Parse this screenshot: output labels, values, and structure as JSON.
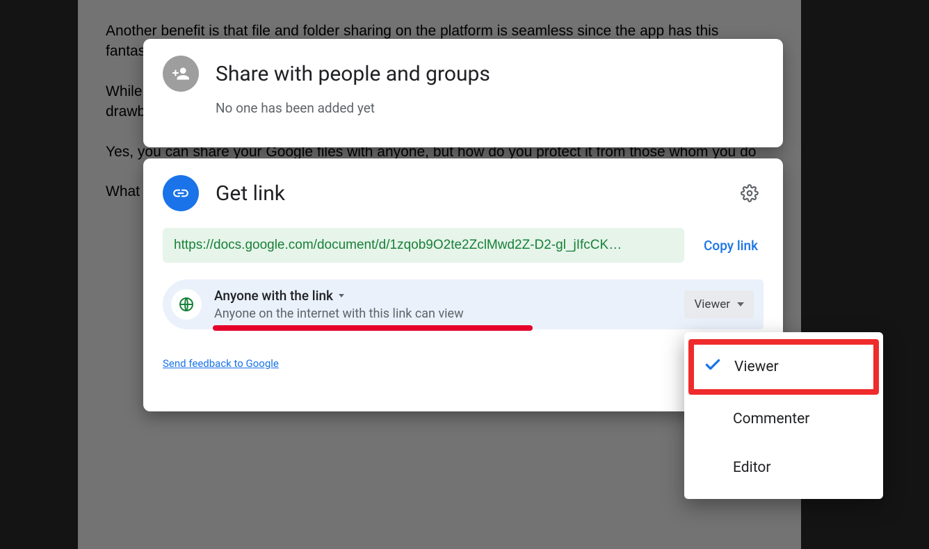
{
  "background_doc": {
    "p1": "Another benefit is that file and folder sharing on the platform is seamless since the app has this fantastic ability to play nice with others. You can allow other users to view, comment, or edit the file by",
    "p2": "While",
    "p2b": "drawb",
    "p3": "Yes, you can share your Google files with anyone, but how do you protect it from those whom you do",
    "p4": "What "
  },
  "share_dialog": {
    "title": "Share with people and groups",
    "subtitle": "No one has been added yet"
  },
  "link_dialog": {
    "title": "Get link",
    "url": "https://docs.google.com/document/d/1zqob9O2te2ZclMwd2Z-D2-gl_jIfcCK…",
    "copy_label": "Copy link",
    "access_scope": "Anyone with the link",
    "access_description": "Anyone on the internet with this link can view",
    "role_selected": "Viewer",
    "feedback_label": "Send feedback to Google"
  },
  "role_menu": {
    "items": [
      "Viewer",
      "Commenter",
      "Editor"
    ],
    "selected": "Viewer"
  },
  "icons": {
    "person_add": "person-add-icon",
    "link": "link-icon",
    "gear": "gear-icon",
    "globe": "globe-icon",
    "check": "check-icon",
    "caret": "caret-down-icon"
  }
}
